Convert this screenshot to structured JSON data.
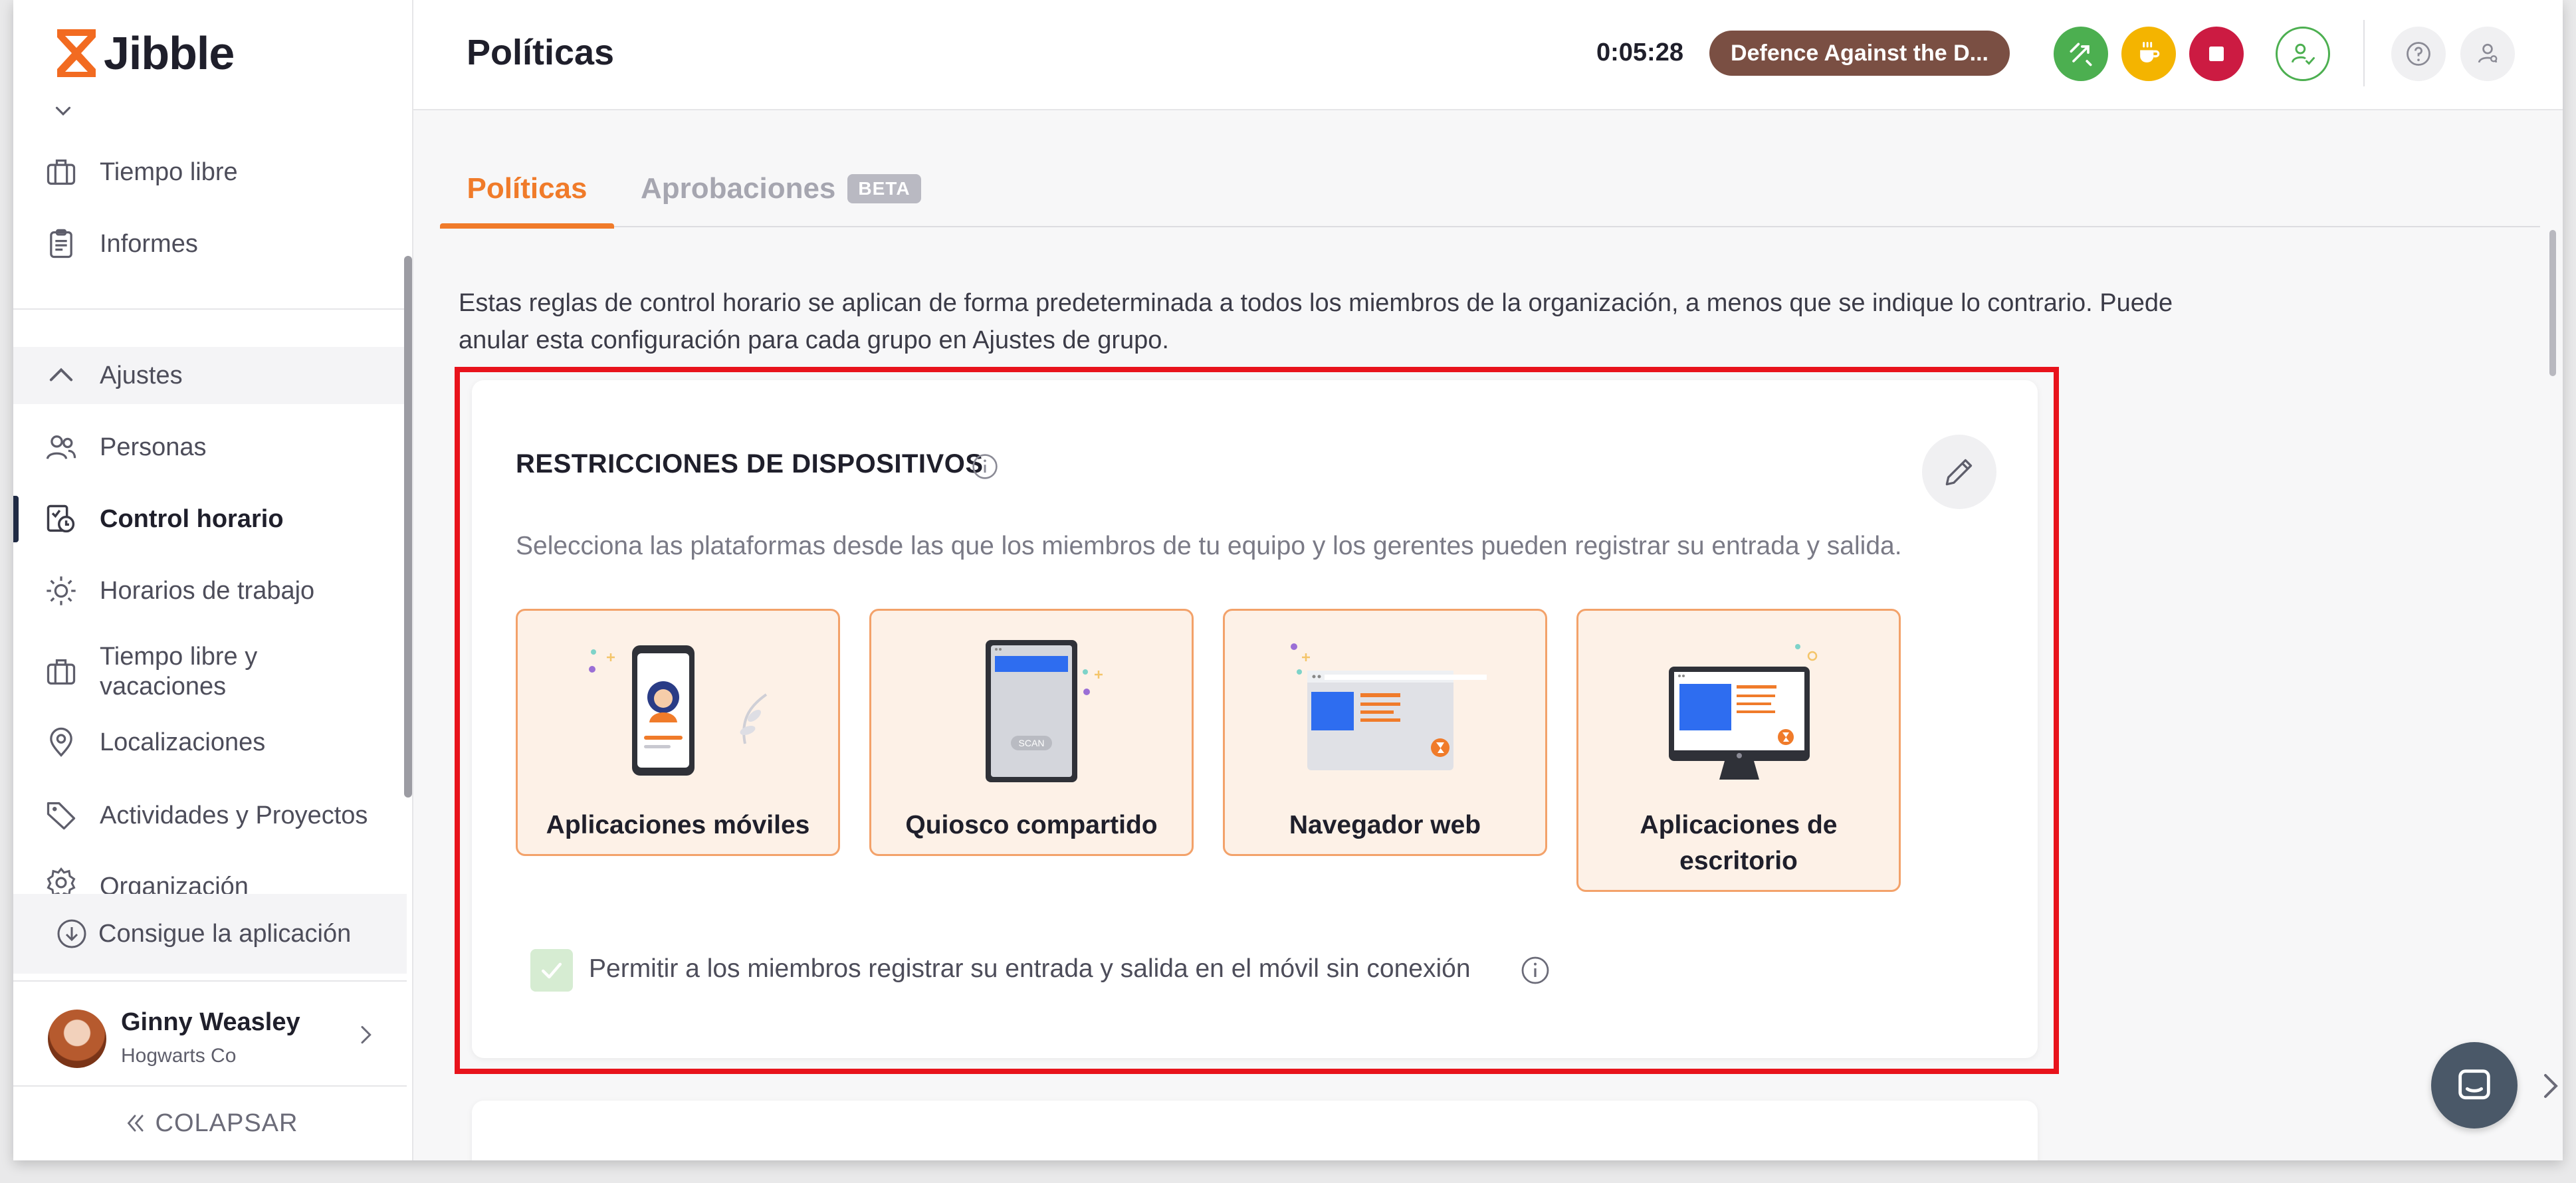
{
  "app": {
    "name": "Jibble"
  },
  "sidebar": {
    "items_top": [
      {
        "label": "Tiempo libre",
        "icon": "briefcase-icon"
      },
      {
        "label": "Informes",
        "icon": "clipboard-icon"
      }
    ],
    "section_label": "Ajustes",
    "items": [
      {
        "label": "Personas",
        "icon": "people-icon"
      },
      {
        "label": "Control horario",
        "icon": "time-tracking-icon"
      },
      {
        "label": "Horarios de trabajo",
        "icon": "sun-icon"
      },
      {
        "label": "Tiempo libre y vacaciones",
        "icon": "briefcase-icon"
      },
      {
        "label": "Localizaciones",
        "icon": "location-pin-icon"
      },
      {
        "label": "Actividades y Proyectos",
        "icon": "tag-icon"
      },
      {
        "label": "Organización",
        "icon": "gear-icon"
      }
    ],
    "get_app": "Consigue la aplicación",
    "user": {
      "name": "Ginny Weasley",
      "org": "Hogwarts Co"
    },
    "collapse_label": "COLAPSAR"
  },
  "header": {
    "title": "Políticas",
    "timer": "0:05:28",
    "activity": "Defence Against the D..."
  },
  "tabs": [
    {
      "label": "Políticas"
    },
    {
      "label": "Aprobaciones",
      "badge": "BETA"
    }
  ],
  "intro_text": "Estas reglas de control horario se aplican de forma predeterminada a todos los miembros de la organización, a menos que se indique lo contrario. Puede anular esta configuración para cada grupo en Ajustes de grupo.",
  "device_restrictions": {
    "title": "RESTRICCIONES DE DISPOSITIVOS",
    "description": "Selecciona las plataformas desde las que los miembros de tu equipo y los gerentes pueden registrar su entrada y salida.",
    "platforms": [
      {
        "label": "Aplicaciones móviles"
      },
      {
        "label": "Quiosco compartido",
        "scan_text": "SCAN"
      },
      {
        "label": "Navegador web"
      },
      {
        "label": "Aplicaciones de escritorio"
      }
    ],
    "offline_checkbox": {
      "label": "Permitir a los miembros registrar su entrada y salida en el móvil sin conexión",
      "checked": true
    }
  },
  "colors": {
    "accent": "#f07b2a",
    "platform_bg": "#fdf1e7",
    "highlight": "#e8131c",
    "activity_pill": "#7a4f43"
  }
}
